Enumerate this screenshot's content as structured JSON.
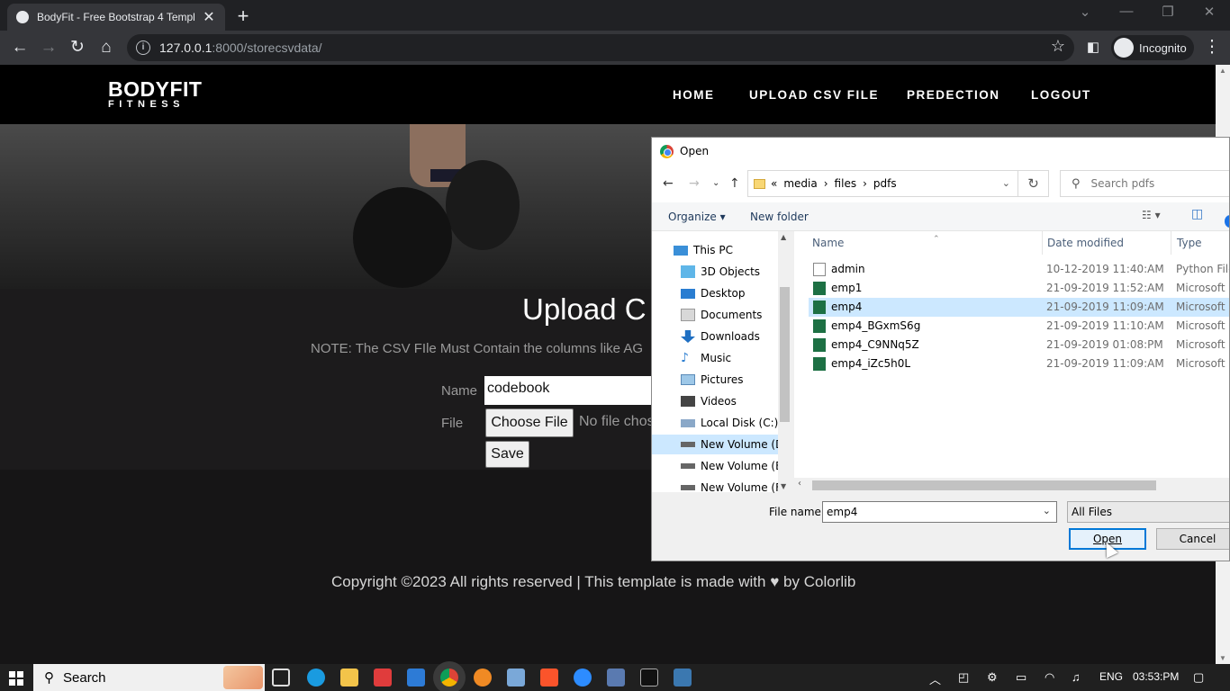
{
  "browser": {
    "tab_title": "BodyFit - Free Bootstrap 4 Templ",
    "tab_close": "✕",
    "new_tab": "+",
    "url_host": "127.0.0.1",
    "url_path": ":8000/storecsvdata/",
    "incognito_label": "Incognito"
  },
  "site": {
    "brand_main": "BODYFIT",
    "brand_sub": "FITNESS",
    "nav": [
      "HOME",
      "UPLOAD CSV FILE",
      "PREDECTION",
      "LOGOUT"
    ],
    "upload_title": "Upload C",
    "note": "NOTE: The CSV FIle Must Contain the columns like AG",
    "name_label": "Name",
    "name_value": "codebook",
    "file_label": "File",
    "choose_file": "Choose File",
    "no_file": "No file chos",
    "save_label": "Save",
    "copyright_pre": "Copyright ©2023 All rights reserved | This template is made with",
    "copyright_post": "by Colorlib"
  },
  "dialog": {
    "title": "Open",
    "path_prefix": "«",
    "path": [
      "media",
      "files",
      "pdfs"
    ],
    "search_placeholder": "Search pdfs",
    "organize": "Organize ▾",
    "new_folder": "New folder",
    "nav_items": [
      {
        "label": "This PC",
        "icon": "pc-icon",
        "color": "#3a8fd8"
      },
      {
        "label": "3D Objects",
        "icon": "cube-icon",
        "color": "#5fb6e8"
      },
      {
        "label": "Desktop",
        "icon": "desktop-icon",
        "color": "#2a7dd1"
      },
      {
        "label": "Documents",
        "icon": "documents-icon",
        "color": "#c8c8c8"
      },
      {
        "label": "Downloads",
        "icon": "downloads-icon",
        "color": "#1f6fc2"
      },
      {
        "label": "Music",
        "icon": "music-icon",
        "color": "#2a7dd1"
      },
      {
        "label": "Pictures",
        "icon": "pictures-icon",
        "color": "#9ec8e8"
      },
      {
        "label": "Videos",
        "icon": "videos-icon",
        "color": "#444"
      },
      {
        "label": "Local Disk (C:)",
        "icon": "drive-icon",
        "color": "#8aa8c8"
      },
      {
        "label": "New Volume (D:",
        "icon": "drive-icon",
        "color": "#666"
      },
      {
        "label": "New Volume (E:)",
        "icon": "drive-icon",
        "color": "#666"
      },
      {
        "label": "New Volume (F:)",
        "icon": "drive-icon",
        "color": "#666"
      }
    ],
    "columns": [
      "Name",
      "Date modified",
      "Type"
    ],
    "files": [
      {
        "name": "admin",
        "date": "10-12-2019 11:40:AM",
        "type": "Python File",
        "icon": "python-file-icon"
      },
      {
        "name": "emp1",
        "date": "21-09-2019 11:52:AM",
        "type": "Microsoft E",
        "icon": "excel-file-icon"
      },
      {
        "name": "emp4",
        "date": "21-09-2019 11:09:AM",
        "type": "Microsoft E",
        "icon": "excel-file-icon",
        "selected": true
      },
      {
        "name": "emp4_BGxmS6g",
        "date": "21-09-2019 11:10:AM",
        "type": "Microsoft E",
        "icon": "excel-file-icon"
      },
      {
        "name": "emp4_C9NNq5Z",
        "date": "21-09-2019 01:08:PM",
        "type": "Microsoft E",
        "icon": "excel-file-icon"
      },
      {
        "name": "emp4_iZc5h0L",
        "date": "21-09-2019 11:09:AM",
        "type": "Microsoft E",
        "icon": "excel-file-icon"
      }
    ],
    "filename_label": "File name:",
    "filename_value": "emp4",
    "filetype": "All Files",
    "open_label": "Open",
    "cancel_label": "Cancel"
  },
  "taskbar": {
    "search_label": "Search",
    "lang": "ENG",
    "time": "03:53:PM"
  }
}
